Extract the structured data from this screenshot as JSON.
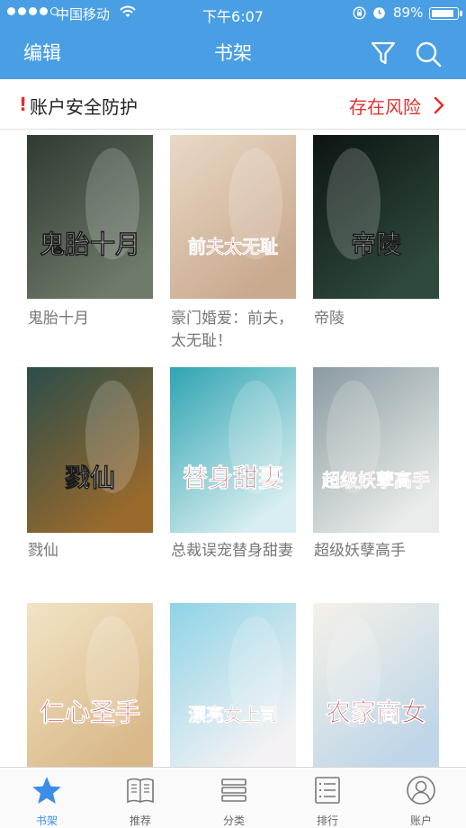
{
  "status_bar": {
    "carrier": "中国移动",
    "time": "下午6:07",
    "battery": "89%",
    "battery_level": 0.89,
    "signal_bars_filled": 4
  },
  "nav": {
    "edit": "编辑",
    "title": "书架",
    "icons": [
      "filter-icon",
      "search-icon"
    ]
  },
  "security": {
    "mark": "!",
    "label": "账户安全防护",
    "status": "存在风险"
  },
  "books": [
    {
      "title": "鬼胎十月",
      "cover_text": "鬼胎十月",
      "cover_colors": [
        "#2f3a32",
        "#6f7a6a"
      ]
    },
    {
      "title": "豪门婚爱：前夫，太无耻！",
      "cover_text": "前夫太无耻",
      "cover_colors": [
        "#e9d9c6",
        "#c9a98e"
      ]
    },
    {
      "title": "帝陵",
      "cover_text": "帝陵",
      "cover_colors": [
        "#0d1412",
        "#2f4a3c"
      ]
    },
    {
      "title": "戮仙",
      "cover_text": "戮仙",
      "cover_colors": [
        "#2c4d4a",
        "#9a6a2c"
      ]
    },
    {
      "title": "总裁误宠替身甜妻",
      "cover_text": "替身甜妻",
      "cover_colors": [
        "#2fa4b2",
        "#d9eef0"
      ]
    },
    {
      "title": "超级妖孽高手",
      "cover_text": "超级妖孽高手",
      "cover_colors": [
        "#8a9aa0",
        "#e9ecea"
      ]
    },
    {
      "title": "",
      "cover_text": "仁心圣手",
      "cover_colors": [
        "#f2e4c6",
        "#d9b98a"
      ]
    },
    {
      "title": "",
      "cover_text": "漂亮女上司",
      "cover_colors": [
        "#8fd3e6",
        "#f4f2f4"
      ]
    },
    {
      "title": "",
      "cover_text": "农家商女",
      "cover_colors": [
        "#f5f1e8",
        "#bfd6e8"
      ]
    }
  ],
  "tabs": [
    {
      "label": "书架",
      "icon": "star-icon",
      "active": true
    },
    {
      "label": "推荐",
      "icon": "book-icon",
      "active": false
    },
    {
      "label": "分类",
      "icon": "stack-icon",
      "active": false
    },
    {
      "label": "排行",
      "icon": "list-icon",
      "active": false
    },
    {
      "label": "账户",
      "icon": "user-icon",
      "active": false
    }
  ],
  "colors": {
    "nav_bar": "#4a9fe4",
    "risk": "#e0302c",
    "tab_active": "#3a8ee6",
    "book_title": "#777777"
  }
}
